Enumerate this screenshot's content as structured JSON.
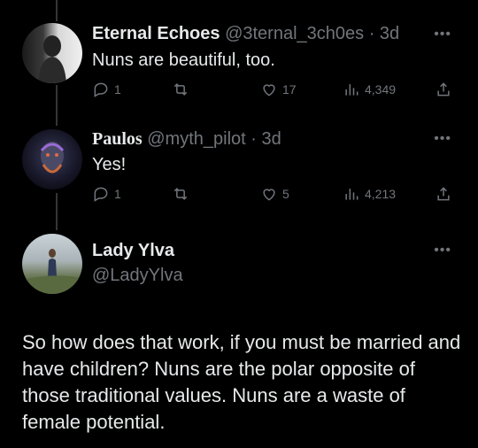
{
  "posts": [
    {
      "name": "Eternal Echoes",
      "handle": "@3ternal_3ch0es",
      "time": "· 3d",
      "text": "Nuns are beautiful, too.",
      "replies": "1",
      "likes": "17",
      "views": "4,349"
    },
    {
      "name": "Paulos",
      "handle": "@myth_pilot",
      "time": "· 3d",
      "text": "Yes!",
      "replies": "1",
      "likes": "5",
      "views": "4,213"
    }
  ],
  "main_post": {
    "name": "Lady Ylva",
    "handle": "@LadyYlva",
    "text": "So how does that work, if you must be married and have children? Nuns are the polar opposite of those traditional values. Nuns are a waste of female potential."
  },
  "more_icon": "•••",
  "icons": [
    "reply-icon",
    "retweet-icon",
    "like-icon",
    "views-icon",
    "share-icon",
    "more-icon"
  ]
}
